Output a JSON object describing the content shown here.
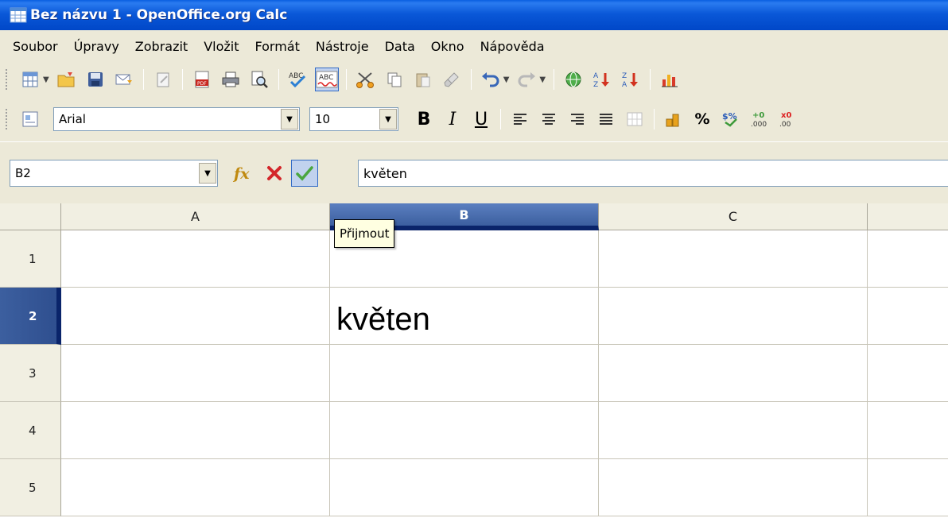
{
  "window": {
    "title": "Bez názvu 1 - OpenOffice.org Calc"
  },
  "menu": [
    "Soubor",
    "Úpravy",
    "Zobrazit",
    "Vložit",
    "Formát",
    "Nástroje",
    "Data",
    "Okno",
    "Nápověda"
  ],
  "format_toolbar": {
    "font_name": "Arial",
    "font_size": "10",
    "bold": "B",
    "italic": "I",
    "underline": "U",
    "percent": "%"
  },
  "formula_bar": {
    "name_box": "B2",
    "input_value": "květen"
  },
  "tooltip": {
    "text": "Přijmout"
  },
  "sheet": {
    "columns": [
      "A",
      "B",
      "C"
    ],
    "rows": [
      "1",
      "2",
      "3",
      "4",
      "5"
    ],
    "selected_cell": "B2",
    "cells": {
      "B2": "květen"
    }
  },
  "colors": {
    "titlebar": "#0a58d8",
    "selection_header": "#3c5f9f",
    "tooltip_bg": "#ffffe1"
  }
}
